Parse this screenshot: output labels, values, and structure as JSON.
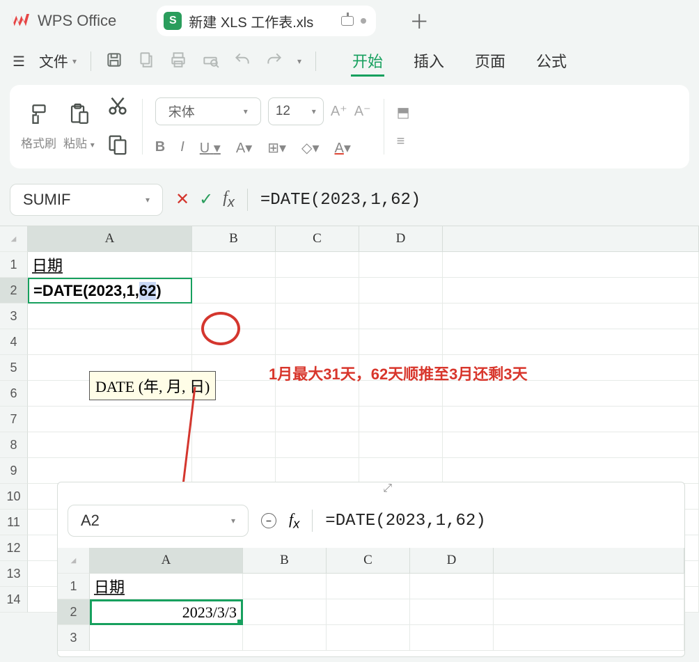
{
  "app": {
    "name": "WPS Office"
  },
  "tab": {
    "badge": "S",
    "name": "新建 XLS 工作表.xls"
  },
  "menu": {
    "file": "文件",
    "tabs": {
      "start": "开始",
      "insert": "插入",
      "page": "页面",
      "formula": "公式"
    }
  },
  "ribbon": {
    "format_painter": "格式刷",
    "paste": "粘贴",
    "font_name": "宋体",
    "font_size": "12",
    "bold": "B",
    "italic": "I",
    "underline": "U"
  },
  "namebox": "SUMIF",
  "formula": "=DATE(2023,1,62)",
  "grid": {
    "cols": {
      "A": "A",
      "B": "B",
      "C": "C",
      "D": "D"
    },
    "A1": "日期",
    "A2_prefix": "=DATE(2023,1,",
    "A2_hl": "62",
    "A2_suffix": ")"
  },
  "tooltip": "DATE (年, 月, 日)",
  "annotation": "1月最大31天，62天顺推至3月还剩3天",
  "result": {
    "namebox": "A2",
    "formula": "=DATE(2023,1,62)",
    "A1": "日期",
    "A2": "2023/3/3"
  }
}
